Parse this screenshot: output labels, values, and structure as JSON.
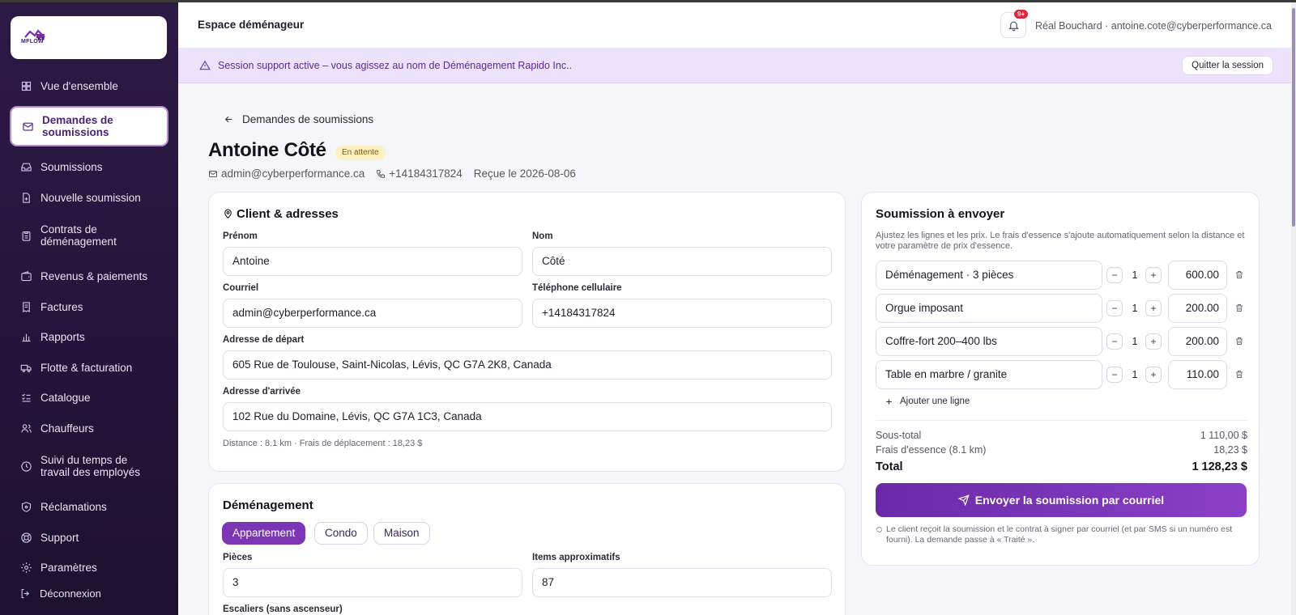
{
  "app": {
    "logo_text": "MFLOW",
    "section_title": "Espace déménageur",
    "notification_count": "9+",
    "user_label": "Réal Bouchard · antoine.cote@cyberperformance.ca"
  },
  "sidebar": {
    "items": [
      {
        "label": "Vue d'ensemble",
        "icon": "dashboard-icon",
        "active": false
      },
      {
        "label": "Demandes de soumissions",
        "icon": "mail-icon",
        "active": true
      },
      {
        "label": "Soumissions",
        "icon": "inbox-icon",
        "active": false
      },
      {
        "label": "Nouvelle soumission",
        "icon": "file-plus-icon",
        "active": false
      },
      {
        "label": "Contrats de déménagement",
        "icon": "clipboard-icon",
        "active": false
      },
      {
        "label": "Revenus & paiements",
        "icon": "wallet-icon",
        "active": false
      },
      {
        "label": "Factures",
        "icon": "receipt-icon",
        "active": false
      },
      {
        "label": "Rapports",
        "icon": "bar-chart-icon",
        "active": false
      },
      {
        "label": "Flotte & facturation",
        "icon": "truck-icon",
        "active": false
      },
      {
        "label": "Catalogue",
        "icon": "list-check-icon",
        "active": false
      },
      {
        "label": "Chauffeurs",
        "icon": "users-icon",
        "active": false
      },
      {
        "label": "Suivi du temps de travail des employés",
        "icon": "clock-icon",
        "active": false
      },
      {
        "label": "Réclamations",
        "icon": "shield-icon",
        "active": false
      },
      {
        "label": "Support",
        "icon": "lifebuoy-icon",
        "active": false
      },
      {
        "label": "Paramètres",
        "icon": "gear-icon",
        "active": false
      }
    ],
    "logout_label": "Déconnexion"
  },
  "banner": {
    "text": "Session support active – vous agissez au nom de Déménagement Rapido Inc..",
    "quit_label": "Quitter la session"
  },
  "header": {
    "back_label": "Demandes de soumissions",
    "client_name": "Antoine Côté",
    "status": "En attente",
    "email": "admin@cyberperformance.ca",
    "phone": "+14184317824",
    "received": "Reçue le 2026-08-06"
  },
  "client_card": {
    "title": "Client & adresses",
    "first_name_label": "Prénom",
    "first_name": "Antoine",
    "last_name_label": "Nom",
    "last_name": "Côté",
    "email_label": "Courriel",
    "email": "admin@cyberperformance.ca",
    "phone_label": "Téléphone cellulaire",
    "phone": "+14184317824",
    "from_label": "Adresse de départ",
    "from": "605 Rue de Toulouse, Saint-Nicolas, Lévis, QC G7A 2K8, Canada",
    "to_label": "Adresse d'arrivée",
    "to": "102 Rue du Domaine, Lévis, QC G7A 1C3, Canada",
    "distance_note": "Distance : 8.1 km · Frais de déplacement : 18,23 $"
  },
  "move_card": {
    "title": "Déménagement",
    "types": [
      "Appartement",
      "Condo",
      "Maison"
    ],
    "selected_type": "Appartement",
    "rooms_label": "Pièces",
    "rooms": "3",
    "items_label": "Items approximatifs",
    "items": "87",
    "stairs_label": "Escaliers (sans ascenseur)"
  },
  "quote_card": {
    "title": "Soumission à envoyer",
    "description": "Ajustez les lignes et les prix. Le frais d'essence s'ajoute automatiquement selon la distance et votre paramètre de prix d'essence.",
    "lines": [
      {
        "name": "Déménagement · 3 pièces",
        "qty": "1",
        "price": "600.00"
      },
      {
        "name": "Orgue imposant",
        "qty": "1",
        "price": "200.00"
      },
      {
        "name": "Coffre-fort 200–400 lbs",
        "qty": "1",
        "price": "200.00"
      },
      {
        "name": "Table en marbre / granite",
        "qty": "1",
        "price": "110.00"
      }
    ],
    "minus": "−",
    "plus": "+",
    "add_line_label": "Ajouter une ligne",
    "subtotal_label": "Sous-total",
    "subtotal": "1 110,00 $",
    "fuel_label": "Frais d'essence (8.1 km)",
    "fuel": "18,23 $",
    "total_label": "Total",
    "total": "1 128,23 $",
    "send_label": "Envoyer la soumission par courriel",
    "send_note": "Le client reçoit la soumission et le contrat à signer par courriel (et par SMS si un numéro est fourni). La demande passe à « Traité »."
  },
  "colors": {
    "sidebar_bg": "#2c1a45",
    "accent": "#7b35b5",
    "banner_bg": "#ece2fb",
    "badge_bg": "#fdf0c2",
    "notification_badge": "#e0243c"
  }
}
